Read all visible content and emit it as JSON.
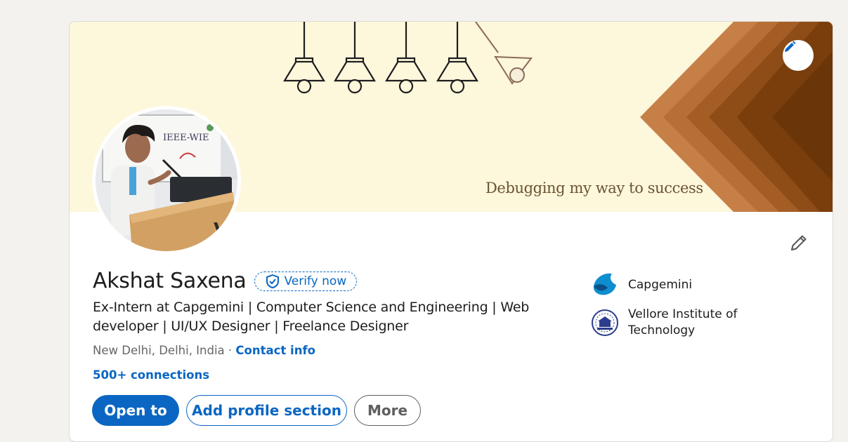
{
  "profile": {
    "name": "Akshat Saxena",
    "verify_label": "Verify now",
    "headline": "Ex-Intern at Capgemini | Computer Science and Engineering | Web developer | UI/UX Designer | Freelance Designer",
    "location": "New Delhi, Delhi, India",
    "location_separator": " · ",
    "contact_label": "Contact info",
    "connections_label": "500+ connections"
  },
  "banner": {
    "tagline": "Debugging my way to success",
    "edit_icon": "pencil-icon"
  },
  "avatar": {
    "name_board_text": "IEEE-WIE"
  },
  "organizations": [
    {
      "name": "Capgemini",
      "logo": "capgemini-logo"
    },
    {
      "name": "Vellore Institute of Technology",
      "logo": "vit-logo"
    }
  ],
  "actions": {
    "open_to_label": "Open to",
    "add_section_label": "Add profile section",
    "more_label": "More"
  },
  "colors": {
    "brand_blue": "#0a66c2",
    "banner_bg": "#fdf7dc",
    "page_bg": "#f4f2ee"
  }
}
